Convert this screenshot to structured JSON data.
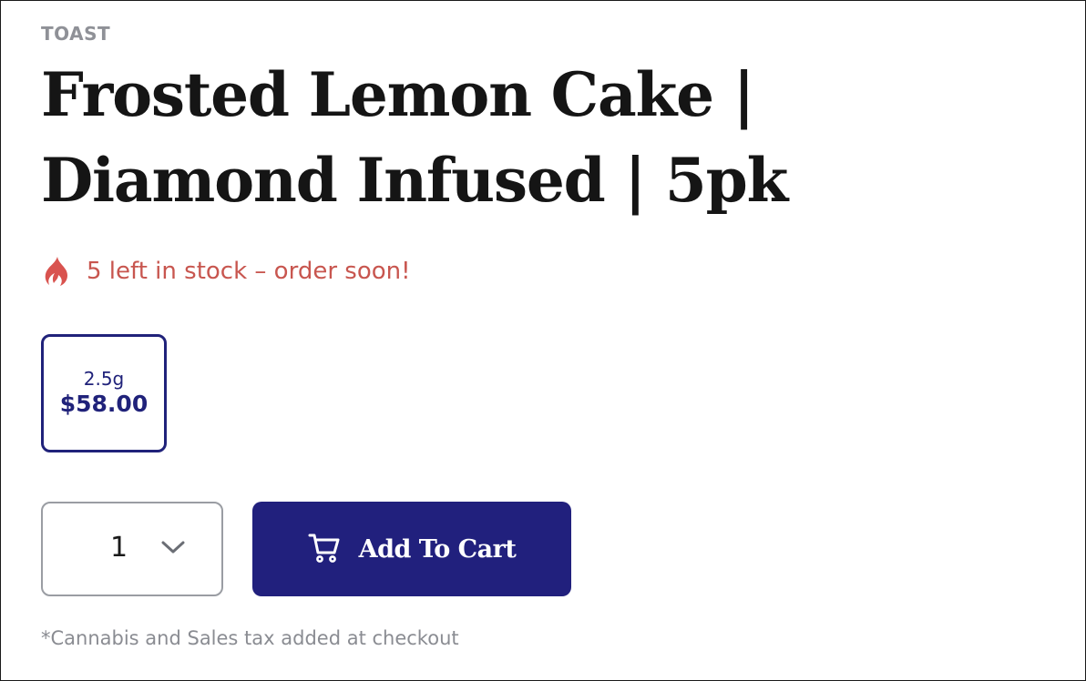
{
  "product": {
    "brand": "TOAST",
    "title": "Frosted Lemon Cake | Diamond Infused | 5pk",
    "stock_notice": "5 left in stock – order soon!",
    "stock_icon": "flame-icon",
    "variants": [
      {
        "weight": "2.5g",
        "price": "$58.00",
        "selected": true
      }
    ],
    "quantity": {
      "value": "1",
      "icon": "chevron-down-icon"
    },
    "add_to_cart": {
      "label": "Add To Cart",
      "icon": "cart-icon"
    },
    "tax_note": "*Cannabis and Sales tax added at checkout"
  },
  "colors": {
    "brand_navy": "#21207d",
    "stock_red": "#c8564f",
    "muted_gray": "#8f9197",
    "title_black": "#151515"
  }
}
